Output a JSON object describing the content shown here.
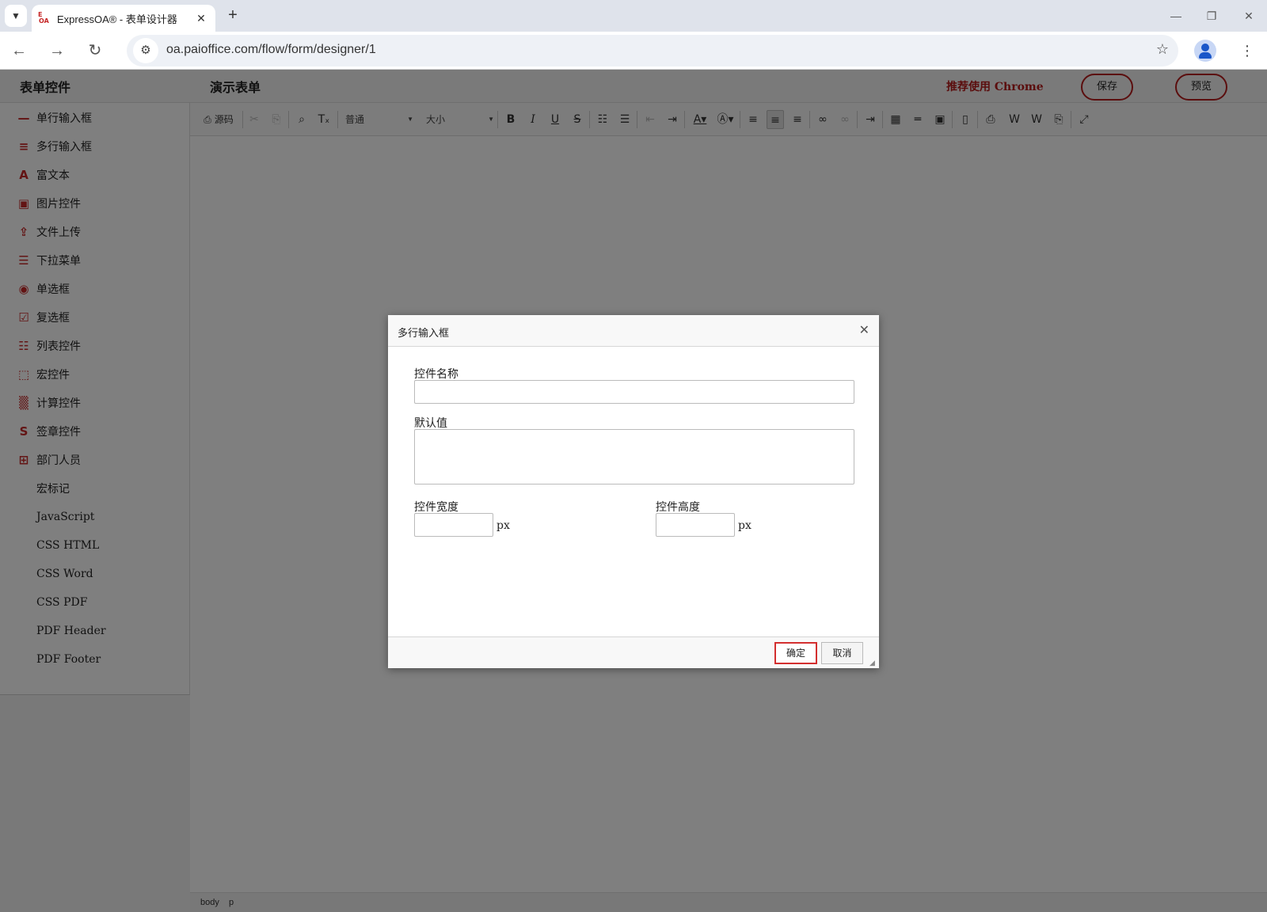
{
  "browser": {
    "tab_title": "ExpressOA® - 表单设计器",
    "favicon_top": "E",
    "favicon_bottom": "OA",
    "new_tab": "+",
    "url": "oa.paioffice.com/flow/form/designer/1"
  },
  "header": {
    "left_title": "表单控件",
    "form_title": "演示表单",
    "recommend": "推荐使用 Chrome",
    "save_label": "保存",
    "preview_label": "预览"
  },
  "sidebar": {
    "items": [
      {
        "label": "单行输入框",
        "icon": "single-line-icon"
      },
      {
        "label": "多行输入框",
        "icon": "multi-line-icon"
      },
      {
        "label": "富文本",
        "icon": "rich-text-icon"
      },
      {
        "label": "图片控件",
        "icon": "image-icon"
      },
      {
        "label": "文件上传",
        "icon": "file-upload-icon"
      },
      {
        "label": "下拉菜单",
        "icon": "dropdown-icon"
      },
      {
        "label": "单选框",
        "icon": "radio-icon"
      },
      {
        "label": "复选框",
        "icon": "checkbox-icon"
      },
      {
        "label": "列表控件",
        "icon": "list-icon"
      },
      {
        "label": "宏控件",
        "icon": "macro-icon"
      },
      {
        "label": "计算控件",
        "icon": "calculator-icon"
      },
      {
        "label": "签章控件",
        "icon": "signature-icon"
      },
      {
        "label": "部门人员",
        "icon": "department-icon"
      },
      {
        "label": "宏标记",
        "icon": ""
      },
      {
        "label": "JavaScript",
        "icon": ""
      },
      {
        "label": "CSS HTML",
        "icon": ""
      },
      {
        "label": "CSS Word",
        "icon": ""
      },
      {
        "label": "CSS PDF",
        "icon": ""
      },
      {
        "label": "PDF Header",
        "icon": ""
      },
      {
        "label": "PDF Footer",
        "icon": ""
      }
    ]
  },
  "toolbar": {
    "source_label": "源码",
    "format_select": "普通",
    "size_select": "大小"
  },
  "pathbar": {
    "items": [
      "body",
      "p"
    ]
  },
  "dialog": {
    "title": "多行输入框",
    "name_label": "控件名称",
    "name_value": "",
    "default_label": "默认值",
    "default_value": "",
    "width_label": "控件宽度",
    "width_value": "",
    "width_unit": "px",
    "height_label": "控件高度",
    "height_value": "",
    "height_unit": "px",
    "ok_label": "确定",
    "cancel_label": "取消"
  },
  "colors": {
    "accent": "#b71c1c",
    "overlay": "rgba(0,0,0,0.5)"
  }
}
